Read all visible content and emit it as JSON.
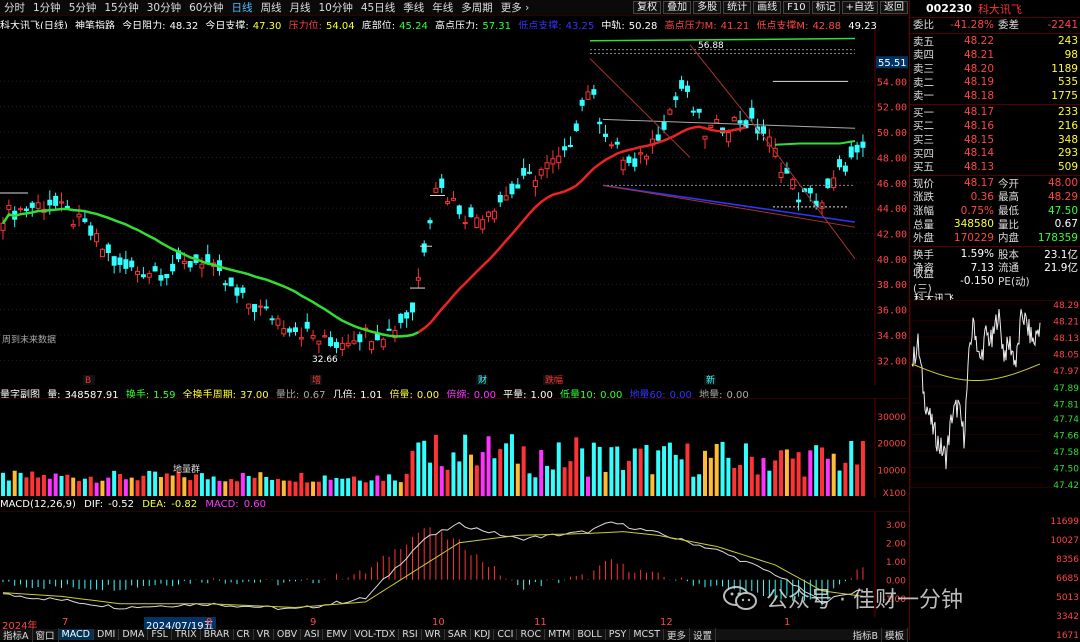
{
  "toolbar": {
    "timeframes": [
      "分时",
      "1分钟",
      "5分钟",
      "15分钟",
      "30分钟",
      "60分钟",
      "日线",
      "周线",
      "月线",
      "10分钟",
      "45日线",
      "季线",
      "年线",
      "多周期",
      "更多 ›"
    ],
    "active": "日线",
    "buttons": [
      "复权",
      "叠加",
      "多股",
      "统计",
      "画线",
      "F10",
      "标记",
      "+自选",
      "返回"
    ]
  },
  "info": {
    "name": "科大讯飞(日线)",
    "ind": "神笔指路",
    "l1": "今日阻力:",
    "v1": "48.32",
    "l2": "今日支撑:",
    "v2": "47.30",
    "l3": "压力位:",
    "v3": "54.04",
    "l4": "底部位:",
    "v4": "45.24",
    "l5": "高点压力:",
    "v5": "57.31",
    "l6": "低点支撑:",
    "v6": "43.25",
    "l7": "中轨:",
    "v7": "50.28",
    "l8": "高点压力M:",
    "v8": "41.21",
    "l9": "低点支撑M:",
    "v9": "42.88",
    "v10": "49.23"
  },
  "main": {
    "yticks": [
      "54.00",
      "52.00",
      "50.00",
      "48.00",
      "46.00",
      "44.00",
      "42.00",
      "40.00",
      "38.00",
      "36.00",
      "34.00",
      "32.00"
    ],
    "price_tag": "55.51",
    "hi_label": "56.88",
    "lo_label": "32.66",
    "note": "周到未来数据",
    "vol_tag": "地量群",
    "markers": [
      "B",
      "增",
      "财",
      "跌幅",
      "新"
    ]
  },
  "volinfo": {
    "a": "量字副图",
    "b": "量:",
    "c": "348587.91",
    "d": "换手:",
    "e": "1.59",
    "f": "全换手周期:",
    "g": "37.00",
    "h": "量比:",
    "i": "0.67",
    "j": "几倍:",
    "k": "1.01",
    "l": "倍量:",
    "m": "0.00",
    "n": "倍缩:",
    "o": "0.00",
    "p": "平量:",
    "q": "1.00",
    "r": "低量10:",
    "s": "0.00",
    "t": "地量60:",
    "u": "0.00",
    "v": "地量:",
    "w": "0.00"
  },
  "vol": {
    "yticks": [
      "30000",
      "20000",
      "10000",
      "X100"
    ]
  },
  "macd": {
    "label": "MACD(12,26,9)",
    "dif_l": "DIF:",
    "dif": "-0.52",
    "dea_l": "DEA:",
    "dea": "-0.82",
    "macd_l": "MACD:",
    "macd": "0.60",
    "yticks": [
      "3.00",
      "2.00",
      "1.00",
      "0.00",
      "-1.00"
    ]
  },
  "dates": {
    "bot": [
      "2024年",
      "7",
      "2024/07/19五",
      "8",
      "9",
      "10",
      "11",
      "12",
      "1"
    ]
  },
  "bottombar": [
    "指标A",
    "窗口",
    "MACD",
    "DMI",
    "DMA",
    "FSL",
    "TRIX",
    "BRAR",
    "CR",
    "VR",
    "OBV",
    "ASI",
    "EMV",
    "VOL-TDX",
    "RSI",
    "WR",
    "SAR",
    "KDJ",
    "CCI",
    "ROC",
    "MTM",
    "BOLL",
    "PSY",
    "MCST",
    "更多",
    "设置"
  ],
  "bottom_active": "MACD",
  "bottombar_right": [
    "指标B",
    "模板"
  ],
  "right": {
    "code": "002230",
    "name": "科大讯飞",
    "wb_l": "委比",
    "wb": "-41.28%",
    "wc_l": "委差",
    "wc": "-2241",
    "asks": [
      {
        "l": "卖五",
        "p": "48.22",
        "v": "243"
      },
      {
        "l": "卖四",
        "p": "48.21",
        "v": "98"
      },
      {
        "l": "卖三",
        "p": "48.20",
        "v": "1189"
      },
      {
        "l": "卖二",
        "p": "48.19",
        "v": "535"
      },
      {
        "l": "卖一",
        "p": "48.18",
        "v": "1775"
      }
    ],
    "bids": [
      {
        "l": "买一",
        "p": "48.17",
        "v": "233"
      },
      {
        "l": "买二",
        "p": "48.16",
        "v": "216"
      },
      {
        "l": "买三",
        "p": "48.15",
        "v": "348"
      },
      {
        "l": "买四",
        "p": "48.14",
        "v": "293"
      },
      {
        "l": "买五",
        "p": "48.13",
        "v": "509"
      }
    ],
    "s1": [
      {
        "l": "现价",
        "v": "48.17",
        "l2": "今开",
        "v2": "48.00"
      },
      {
        "l": "涨跌",
        "v": "0.36",
        "l2": "最高",
        "v2": "48.29"
      },
      {
        "l": "涨幅",
        "v": "0.75%",
        "l2": "最低",
        "v2": "47.50"
      },
      {
        "l": "总量",
        "v": "348580",
        "l2": "量比",
        "v2": "0.67"
      },
      {
        "l": "外盘",
        "v": "170229",
        "l2": "内盘",
        "v2": "178359"
      }
    ],
    "s2": [
      {
        "l": "换手",
        "v": "1.59%",
        "l2": "股本",
        "v2": "23.1亿"
      },
      {
        "l": "净资",
        "v": "7.13",
        "l2": "流通",
        "v2": "21.9亿"
      },
      {
        "l": "收益(三)",
        "v": "-0.150",
        "l2": "PE(动)",
        "v2": ""
      }
    ],
    "mini_title": "科大讯飞",
    "mini_ticks": [
      "48.29",
      "48.21",
      "48.13",
      "48.05",
      "47.97",
      "47.89",
      "47.81",
      "47.74",
      "47.66",
      "47.58",
      "47.50",
      "47.42"
    ],
    "tape_ticks": [
      "11699",
      "10027",
      "8356",
      "6685",
      "5013",
      "3342",
      "1671"
    ]
  },
  "watermark": "公众号 · 佳财一分钟"
}
